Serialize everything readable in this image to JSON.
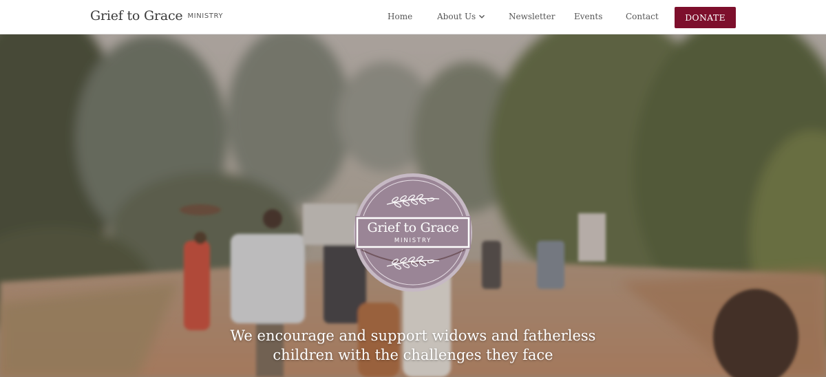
{
  "header": {
    "brand_name": "Grief to Grace",
    "brand_sub": "MINISTRY",
    "nav": [
      {
        "label": "Home"
      },
      {
        "label": "About Us"
      },
      {
        "label": "Newsletter"
      },
      {
        "label": "Events"
      },
      {
        "label": "Contact"
      }
    ],
    "donate_label": "DONATE"
  },
  "hero": {
    "logo_title": "Grief to Grace",
    "logo_sub": "MINISTRY",
    "tagline_line1": "We encourage and support widows and fatherless",
    "tagline_line2": "children with the challenges they face"
  },
  "colors": {
    "donate_bg": "#7d0f2c",
    "logo_badge": "#9a8596",
    "nav_text": "#555555"
  },
  "icons": {
    "about_dropdown": "chevron-down-icon",
    "logo_ornament": "laurel-branch-icon"
  }
}
